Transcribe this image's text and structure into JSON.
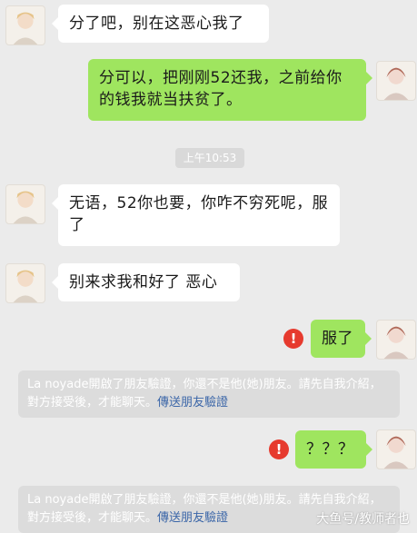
{
  "messages": [
    {
      "side": "in",
      "text": "分了吧，别在这恶心我了"
    },
    {
      "side": "out",
      "text": "分可以，把刚刚52还我，之前给你的钱我就当扶贫了。"
    },
    {
      "side": "in",
      "text": "无语，52你也要，你咋不穷死呢，服了"
    },
    {
      "side": "in",
      "text": "别来求我和好了 恶心"
    },
    {
      "side": "out",
      "text": "服了",
      "failed": true
    },
    {
      "side": "out",
      "text": "？？？",
      "failed": true
    }
  ],
  "timestamp": "上午10:53",
  "error_icon_glyph": "!",
  "system_notice": {
    "text": "La noyade開啟了朋友驗證，你還不是他(她)朋友。請先自我介紹，對方接受後，才能聊天。",
    "link": "傳送朋友驗證"
  },
  "watermark": "大鱼号/教师者也",
  "colors": {
    "background": "#ebebeb",
    "outgoing_bubble": "#9fe55f",
    "incoming_bubble": "#ffffff",
    "error_icon": "#e63a2e",
    "link": "#3b66a8"
  }
}
